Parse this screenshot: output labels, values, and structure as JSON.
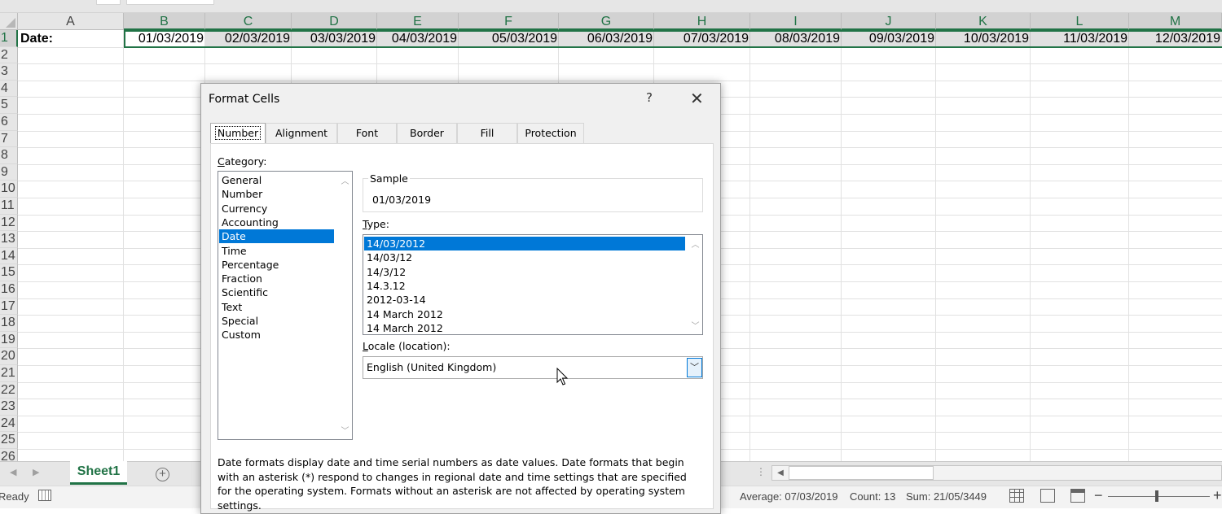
{
  "sheet": {
    "columns": [
      "A",
      "B",
      "C",
      "D",
      "E",
      "F",
      "G",
      "H",
      "I",
      "J",
      "K",
      "L",
      "M"
    ],
    "rows": [
      "1",
      "2",
      "3",
      "4",
      "5",
      "6",
      "7",
      "8",
      "9",
      "10",
      "11",
      "12",
      "13",
      "14",
      "15",
      "16",
      "17",
      "18",
      "19",
      "20",
      "21",
      "22",
      "23",
      "24",
      "25",
      "26"
    ],
    "a1": "Date:",
    "dates": [
      "01/03/2019",
      "02/03/2019",
      "03/03/2019",
      "04/03/2019",
      "05/03/2019",
      "06/03/2019",
      "07/03/2019",
      "08/03/2019",
      "09/03/2019",
      "10/03/2019",
      "11/03/2019",
      "12/03/2019"
    ],
    "tab_name": "Sheet1",
    "add_sheet_glyph": "+"
  },
  "status": {
    "ready": "Ready",
    "average": "Average: 07/03/2019",
    "count": "Count: 13",
    "sum": "Sum: 21/05/3449"
  },
  "dialog": {
    "title": "Format Cells",
    "help": "?",
    "close": "✕",
    "tabs": [
      "Number",
      "Alignment",
      "Font",
      "Border",
      "Fill",
      "Protection"
    ],
    "category_label_u": "C",
    "category_label_rest": "ategory:",
    "categories": [
      "General",
      "Number",
      "Currency",
      "Accounting",
      "Date",
      "Time",
      "Percentage",
      "Fraction",
      "Scientific",
      "Text",
      "Special",
      "Custom"
    ],
    "selected_category": "Date",
    "sample_label": "Sample",
    "sample_value": "01/03/2019",
    "type_label_u": "T",
    "type_label_rest": "ype:",
    "types": [
      "14/03/2012",
      "14/03/12",
      "14/3/12",
      "14.3.12",
      "2012-03-14",
      "14 March 2012",
      "14 March 2012"
    ],
    "selected_type": "14/03/2012",
    "locale_label_u": "L",
    "locale_label_rest": "ocale (location):",
    "locale_value": "English (United Kingdom)",
    "description": "Date formats display date and time serial numbers as date values.  Date formats that begin with an asterisk (*) respond to changes in regional date and time settings that are specified for the operating system. Formats without an asterisk are not affected by operating system settings."
  },
  "colors": {
    "excel_green": "#217346",
    "selection_blue": "#0078d7"
  },
  "icons": {
    "close": "close-icon",
    "help": "help-icon",
    "dropdown": "chevron-down-icon",
    "cursor": "mouse-pointer-icon"
  }
}
